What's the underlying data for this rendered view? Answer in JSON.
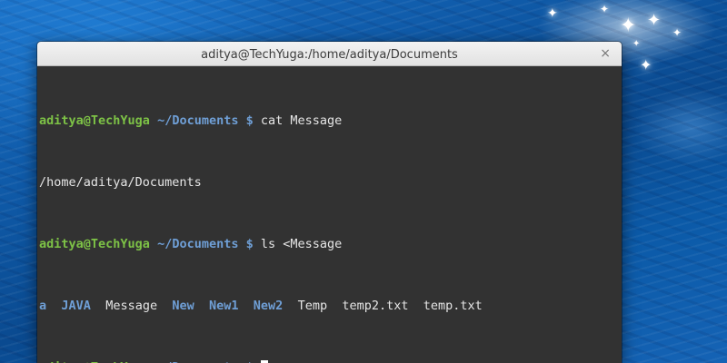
{
  "window": {
    "title": "aditya@TechYuga:/home/aditya/Documents",
    "close_icon": "×"
  },
  "prompt": {
    "user_host": "aditya@TechYuga",
    "path": "~/Documents",
    "symbol": "$"
  },
  "lines": [
    {
      "command": "cat Message"
    },
    {
      "output": "/home/aditya/Documents"
    },
    {
      "command": "ls <Message"
    },
    {
      "ls_entries": [
        {
          "name": "a",
          "type": "dir"
        },
        {
          "name": "JAVA",
          "type": "dir"
        },
        {
          "name": "Message",
          "type": "file"
        },
        {
          "name": "New",
          "type": "dir"
        },
        {
          "name": "New1",
          "type": "dir"
        },
        {
          "name": "New2",
          "type": "dir"
        },
        {
          "name": "Temp",
          "type": "file"
        },
        {
          "name": "temp2.txt",
          "type": "file"
        },
        {
          "name": "temp.txt",
          "type": "file"
        }
      ]
    },
    {
      "command": ""
    }
  ],
  "colors": {
    "user_host": "#7dc246",
    "path": "#6f9fd6",
    "text": "#e6e6e6",
    "terminal_bg": "#323232"
  },
  "icons": {
    "close": "close-icon",
    "sparkle": "sparkle-icon"
  }
}
